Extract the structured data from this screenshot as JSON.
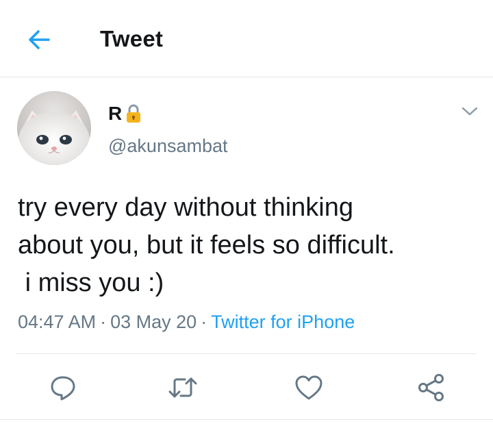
{
  "header": {
    "title": "Tweet",
    "back_icon": "arrow-left-icon"
  },
  "tweet": {
    "author": {
      "display_name": "R",
      "handle": "@akunsambat",
      "protected_icon": "lock-icon",
      "avatar": "cat-photo"
    },
    "text": "try every day without thinking\nabout you, but it feels so difficult.\n i miss you :)",
    "time": "04:47 AM",
    "date": "03 May 20",
    "separator": "·",
    "source": "Twitter for iPhone"
  },
  "actions": {
    "reply_icon": "reply-icon",
    "retweet_icon": "retweet-icon",
    "like_icon": "heart-icon",
    "share_icon": "share-icon"
  },
  "colors": {
    "accent": "#1da1f2",
    "secondary_text": "#657786",
    "primary_text": "#14171a",
    "divider": "#e1e8ed",
    "lock": "#f5b31b"
  }
}
